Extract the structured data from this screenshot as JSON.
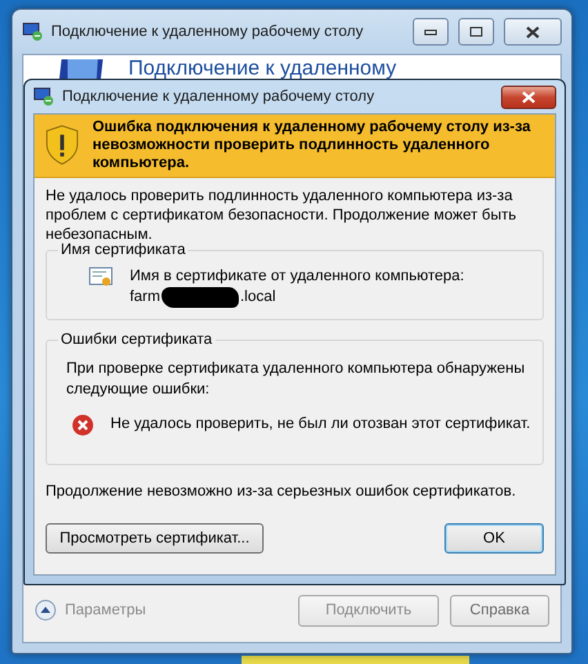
{
  "window": {
    "title": "Подключение к удаленному рабочему столу",
    "header": "Подключение к удаленному",
    "controls": [
      {
        "kind": "minimize"
      },
      {
        "kind": "maximize"
      },
      {
        "kind": "close"
      }
    ]
  },
  "dialog": {
    "title": "Подключение к удаленному рабочему столу",
    "banner": "Ошибка подключения к удаленному рабочему столу из-за невозможности проверить подлинность удаленного компьютера.",
    "intro": "Не удалось проверить подлинность удаленного компьютера из-за проблем с сертификатом безопасности. Продолжение может быть небезопасным.",
    "groups": [
      {
        "kind": "name",
        "heading": "Имя сертификата",
        "text": "Имя в сертификате от удаленного компьютера:",
        "value_start": "farm",
        "value_end": ".local"
      },
      {
        "kind": "errors",
        "heading": "Ошибки сертификата",
        "text": "При проверке сертификата удаленного компьютера обнаружены следующие ошибки:",
        "error": "Не удалось проверить, не был ли отозван этот сертификат."
      }
    ],
    "footer": "Продолжение невозможно из-за серьезных ошибок сертификатов.",
    "buttons": [
      {
        "label": "Просмотреть сертификат...",
        "default": false
      },
      {
        "label": "OK",
        "default": true
      }
    ]
  },
  "bottom": {
    "options": "Параметры",
    "buttons": [
      {
        "label": "Подключить",
        "disabled": true
      },
      {
        "label": "Справка",
        "disabled": false
      }
    ]
  }
}
